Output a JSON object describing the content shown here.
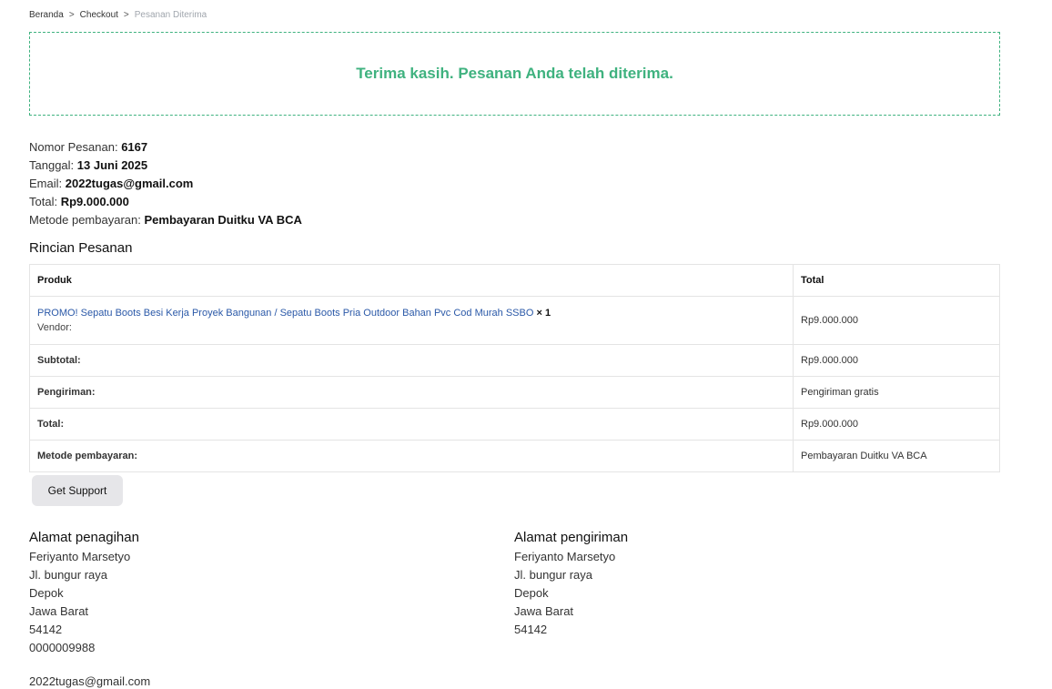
{
  "breadcrumb": {
    "home": "Beranda",
    "checkout": "Checkout",
    "current": "Pesanan Diterima",
    "separator": ">"
  },
  "notice": {
    "text": "Terima kasih. Pesanan Anda telah diterima."
  },
  "overview": {
    "order_number_label": "Nomor Pesanan:",
    "order_number": "6167",
    "date_label": "Tanggal:",
    "date": "13 Juni 2025",
    "email_label": "Email:",
    "email": "2022tugas@gmail.com",
    "total_label": "Total:",
    "total": "Rp9.000.000",
    "payment_label": "Metode pembayaran:",
    "payment": "Pembayaran Duitku VA BCA"
  },
  "details": {
    "title": "Rincian Pesanan",
    "headers": {
      "product": "Produk",
      "total": "Total"
    },
    "product": {
      "name": "PROMO! Sepatu Boots Besi Kerja Proyek Bangunan / Sepatu Boots Pria Outdoor Bahan Pvc Cod Murah SSBO",
      "qty": "× 1",
      "vendor": "Vendor:",
      "total": "Rp9.000.000"
    },
    "rows": {
      "subtotal_label": "Subtotal:",
      "subtotal": "Rp9.000.000",
      "shipping_label": "Pengiriman:",
      "shipping": "Pengiriman gratis",
      "total_label": "Total:",
      "total": "Rp9.000.000",
      "payment_label": "Metode pembayaran:",
      "payment": "Pembayaran Duitku VA BCA"
    }
  },
  "support_button": "Get Support",
  "billing": {
    "title": "Alamat penagihan",
    "name": "Feriyanto Marsetyo",
    "street": "Jl. bungur raya",
    "city": "Depok",
    "province": "Jawa Barat",
    "postcode": "54142",
    "phone": "0000009988",
    "email": "2022tugas@gmail.com"
  },
  "shipping": {
    "title": "Alamat pengiriman",
    "name": "Feriyanto Marsetyo",
    "street": "Jl. bungur raya",
    "city": "Depok",
    "province": "Jawa Barat",
    "postcode": "54142"
  },
  "colors": {
    "success": "#3fb27f",
    "link": "#2b59a8",
    "muted": "#a0a6ad"
  }
}
